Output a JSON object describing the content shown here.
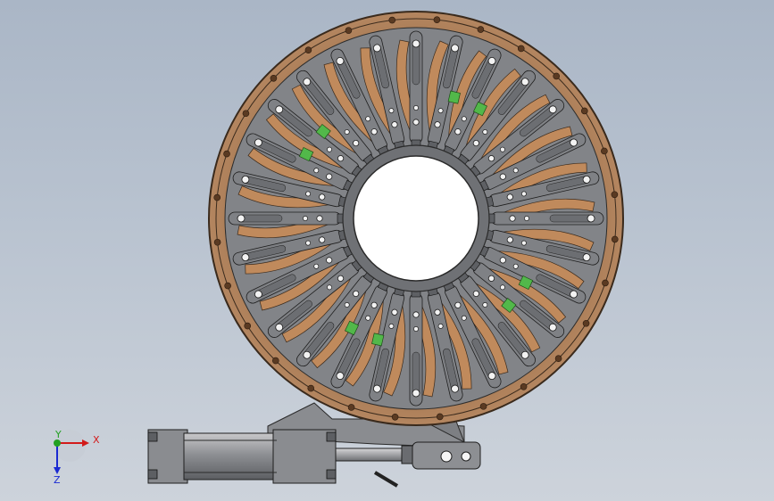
{
  "viewport": {
    "background_top": "#aab6c6",
    "background_bottom": "#cdd3db"
  },
  "model": {
    "ring_color": "#a5764e",
    "segment_color": "#7f8185",
    "cam_color": "#c08a5c",
    "pad_color": "#52b84a",
    "bore_color": "#ffffff",
    "segment_count": 28
  },
  "triad": {
    "x_label": "X",
    "y_label": "Y",
    "z_label": "Z",
    "x_color": "#d21a1a",
    "y_color": "#22a022",
    "z_color": "#1a2ad2"
  },
  "icons": {
    "triad": "axis-triad-icon"
  }
}
